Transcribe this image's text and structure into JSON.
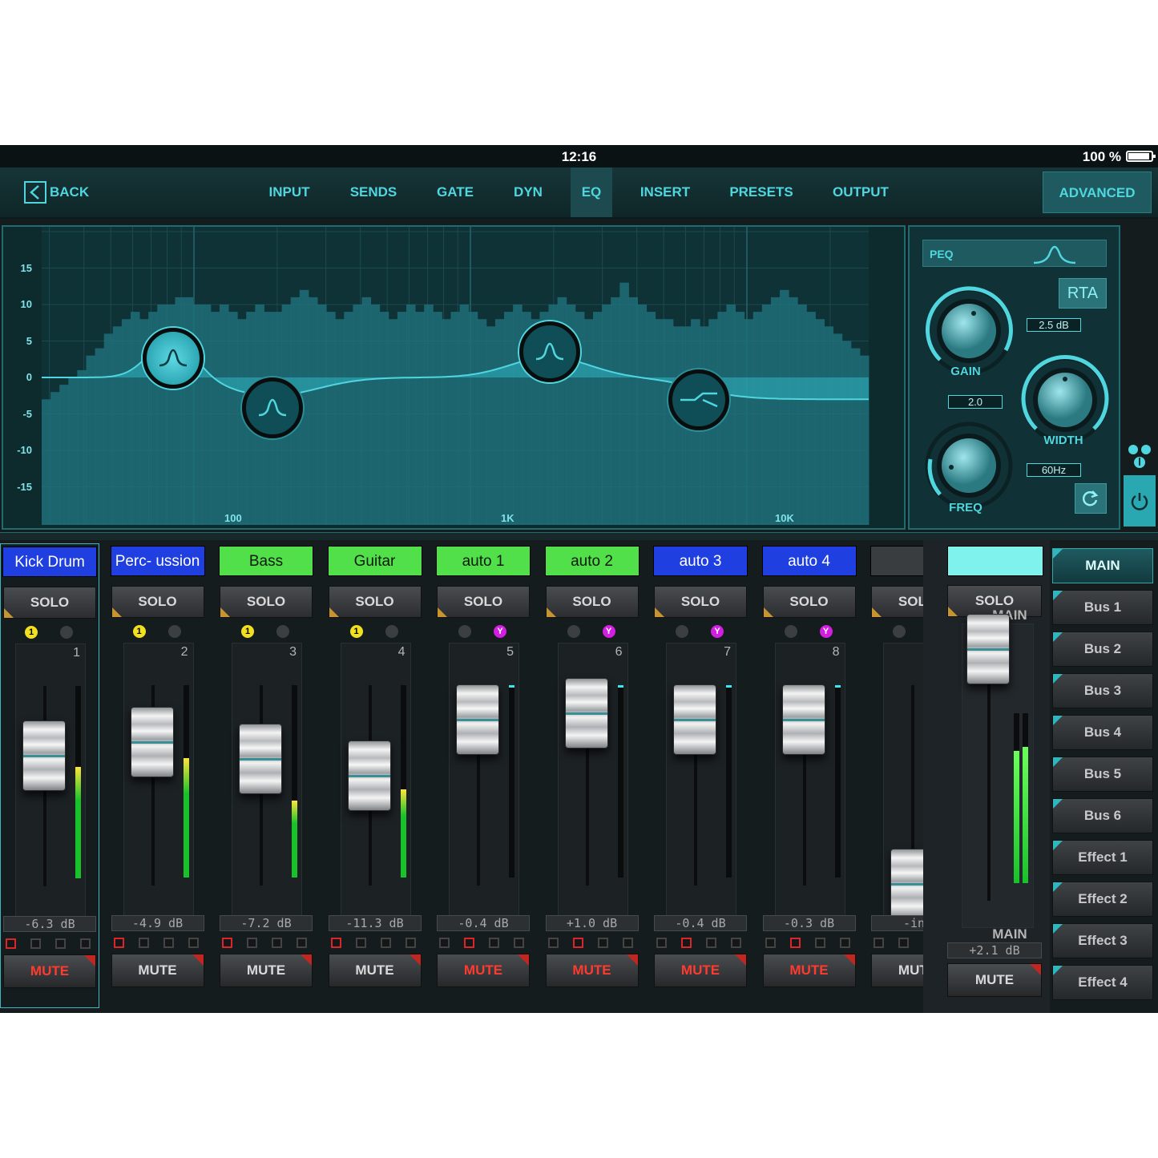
{
  "status": {
    "time": "12:16",
    "battery": "100 %"
  },
  "nav": {
    "back_label": "BACK",
    "tabs": [
      "INPUT",
      "SENDS",
      "GATE",
      "DYN",
      "EQ",
      "INSERT",
      "PRESETS",
      "OUTPUT"
    ],
    "active_tab": "EQ",
    "advanced_label": "ADVANCED"
  },
  "eq": {
    "y_ticks": [
      "15",
      "10",
      "5",
      "0",
      "-5",
      "-10",
      "-15"
    ],
    "x_ticks": [
      "100",
      "1K",
      "10K"
    ],
    "band_type": "PEQ",
    "rta_label": "RTA",
    "gain_label": "GAIN",
    "gain_value": "2.5 dB",
    "width_label": "WIDTH",
    "width_value": "2.0",
    "freq_label": "FREQ",
    "freq_value": "60Hz",
    "colors": {
      "accent": "#4fd6df",
      "rta_fill": "#1f6f78"
    }
  },
  "channels": [
    {
      "name": "Kick Drum",
      "color": "#1f3fe0",
      "solo": "SOLO",
      "num": "1",
      "db": "-6.3 dB",
      "mute": "MUTE",
      "mute_on": true,
      "grp": "yellow",
      "fader": 0.62,
      "meter": 0.58,
      "send": 0
    },
    {
      "name": "Perc- ussion",
      "color": "#1f3fe0",
      "solo": "SOLO",
      "num": "2",
      "db": "-4.9 dB",
      "mute": "MUTE",
      "mute_on": false,
      "grp": "yellow",
      "fader": 0.68,
      "meter": 0.62,
      "send": 0
    },
    {
      "name": "Bass",
      "color": "#52e04a",
      "solo": "SOLO",
      "num": "3",
      "db": "-7.2 dB",
      "mute": "MUTE",
      "mute_on": false,
      "grp": "yellow",
      "fader": 0.6,
      "meter": 0.4,
      "send": 0
    },
    {
      "name": "Guitar",
      "color": "#52e04a",
      "solo": "SOLO",
      "num": "4",
      "db": "-11.3 dB",
      "mute": "MUTE",
      "mute_on": false,
      "grp": "yellow",
      "fader": 0.52,
      "meter": 0.46,
      "send": 0
    },
    {
      "name": "auto 1",
      "color": "#52e04a",
      "solo": "SOLO",
      "num": "5",
      "db": "-0.4 dB",
      "mute": "MUTE",
      "mute_on": true,
      "grp": "magenta",
      "fader": 0.79,
      "meter": 0.0,
      "send": 1
    },
    {
      "name": "auto 2",
      "color": "#52e04a",
      "solo": "SOLO",
      "num": "6",
      "db": "+1.0 dB",
      "mute": "MUTE",
      "mute_on": true,
      "grp": "magenta",
      "fader": 0.82,
      "meter": 0.0,
      "send": 1
    },
    {
      "name": "auto 3",
      "color": "#1f3fe0",
      "solo": "SOLO",
      "num": "7",
      "db": "-0.4 dB",
      "mute": "MUTE",
      "mute_on": true,
      "grp": "magenta",
      "fader": 0.79,
      "meter": 0.0,
      "send": 1
    },
    {
      "name": "auto 4",
      "color": "#1f3fe0",
      "solo": "SOLO",
      "num": "8",
      "db": "-0.3 dB",
      "mute": "MUTE",
      "mute_on": true,
      "grp": "magenta",
      "fader": 0.79,
      "meter": 0.0,
      "send": 1
    },
    {
      "name": "",
      "color": "#3a3d40",
      "solo": "SOLO",
      "num": "",
      "db": "-inf",
      "mute": "MUTE",
      "mute_on": false,
      "grp": "",
      "fader": 0.0,
      "meter": 0.0,
      "send": -1
    }
  ],
  "group_labels": {
    "yellow": "1",
    "magenta": "Y"
  },
  "main": {
    "color": "#7ff2ee",
    "solo": "SOLO",
    "label_top": "MAIN",
    "label_bottom": "MAIN",
    "db": "+2.1 dB",
    "mute": "MUTE",
    "fader": 0.8,
    "meter": 0.78
  },
  "buses": [
    "MAIN",
    "Bus 1",
    "Bus 2",
    "Bus 3",
    "Bus 4",
    "Bus 5",
    "Bus 6",
    "Effect 1",
    "Effect 2",
    "Effect 3",
    "Effect 4"
  ],
  "active_bus": "MAIN"
}
